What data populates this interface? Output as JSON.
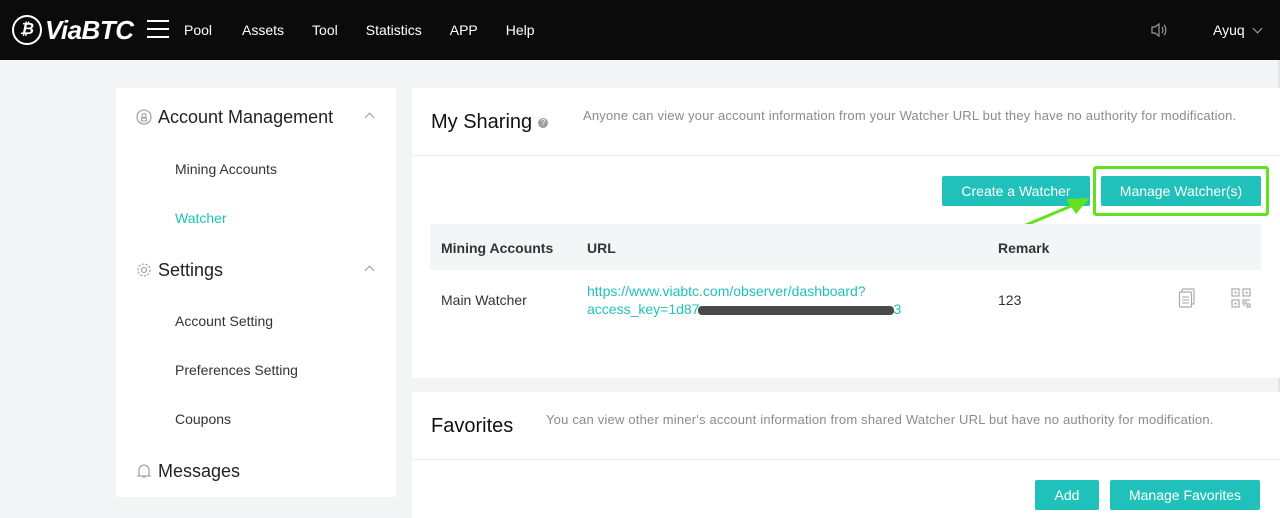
{
  "brand": {
    "name": "ViaBTC"
  },
  "nav": {
    "items": [
      {
        "label": "Pool"
      },
      {
        "label": "Assets"
      },
      {
        "label": "Tool"
      },
      {
        "label": "Statistics"
      },
      {
        "label": "APP"
      },
      {
        "label": "Help"
      }
    ],
    "user": "Ayuq"
  },
  "sidebar": {
    "sections": [
      {
        "title": "Account Management",
        "icon": "account-icon",
        "items": [
          {
            "label": "Mining Accounts",
            "active": false
          },
          {
            "label": "Watcher",
            "active": true
          }
        ]
      },
      {
        "title": "Settings",
        "icon": "gear-icon",
        "items": [
          {
            "label": "Account Setting",
            "active": false
          },
          {
            "label": "Preferences Setting",
            "active": false
          },
          {
            "label": "Coupons",
            "active": false
          }
        ]
      },
      {
        "title": "Messages",
        "icon": "bell-icon",
        "items": []
      }
    ]
  },
  "sharing": {
    "title": "My Sharing",
    "description": "Anyone can view your account information from your Watcher URL but they have no authority for modification.",
    "buttons": {
      "create": "Create a Watcher",
      "manage": "Manage Watcher(s)"
    },
    "table": {
      "headers": [
        "Mining Accounts",
        "URL",
        "Remark"
      ],
      "rows": [
        {
          "account": "Main Watcher",
          "url_line1": "https://www.viabtc.com/observer/dashboard?",
          "url_line2_start": "access_key=1d87",
          "url_line2_end": "3",
          "remark": "123",
          "actions": [
            "copy-icon",
            "qr-code-icon"
          ]
        }
      ]
    }
  },
  "favorites": {
    "title": "Favorites",
    "description": "You can view other miner's account information from shared Watcher URL but have no authority for modification.",
    "buttons": {
      "add": "Add",
      "manage": "Manage Favorites"
    }
  },
  "colors": {
    "accent": "#20c1ba",
    "highlight": "#62e21c",
    "topbar": "#0b0b0b"
  }
}
